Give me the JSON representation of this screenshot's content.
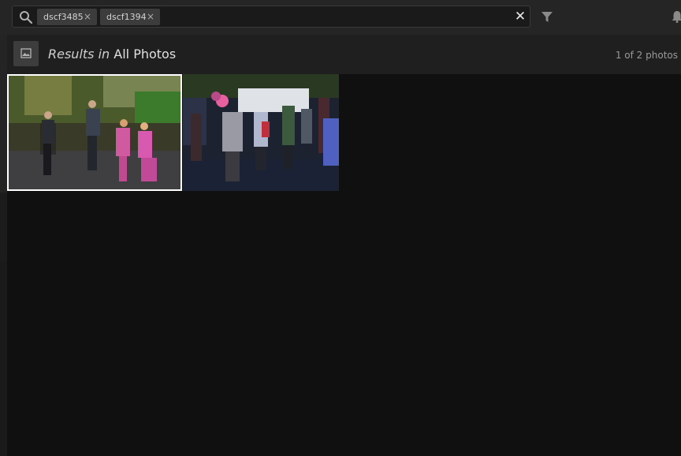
{
  "search": {
    "tags": [
      {
        "label": "dscf3485",
        "remove": "×"
      },
      {
        "label": "dscf1394",
        "remove": "×"
      }
    ],
    "clear_label": "✕"
  },
  "results": {
    "prefix": "Results in",
    "collection": "All Photos",
    "count": "1 of 2 photos"
  },
  "photos": [
    {
      "id": "dscf3485",
      "selected": true
    },
    {
      "id": "dscf1394",
      "selected": false
    }
  ],
  "icons": {
    "search": "search-icon",
    "filter": "filter-icon",
    "notifications": "bell-icon",
    "collection": "image-icon"
  },
  "colors": {
    "selection_border": "#ffffff",
    "background": "#101010",
    "tag_bg": "#3c3c3c"
  }
}
